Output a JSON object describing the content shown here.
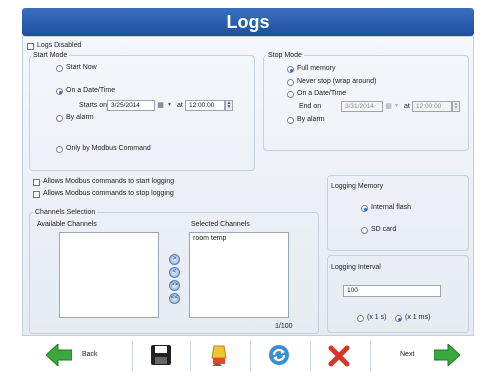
{
  "window": {
    "title": "Logs"
  },
  "options": {
    "logs_disabled": "Logs Disabled"
  },
  "start_mode": {
    "title": "Start Mode",
    "start_now": "Start Now",
    "on_date": "On a Date/Time",
    "starts_on_label": "Starts on",
    "date": "3/25/2014",
    "at_label": "at",
    "time": "12:00:00",
    "by_alarm": "By alarm",
    "only_modbus": "Only by Modbus Command"
  },
  "stop_mode": {
    "title": "Stop Mode",
    "full_memory": "Full memory",
    "never_stop": "Never stop (wrap around)",
    "on_date": "On a Date/Time",
    "end_on_label": "End on",
    "date": "3/31/2014",
    "at_label": "at",
    "time": "12:00:00",
    "by_alarm": "By alarm"
  },
  "modbus": {
    "start": "Allows Modbus commands to start logging",
    "stop": "Allows Modbus commands to stop logging"
  },
  "channels": {
    "title": "Channels Selection",
    "available_label": "Available Channels",
    "selected_label": "Selected Channels",
    "selected_items": [
      "room temp"
    ],
    "count": "1/100",
    "move_buttons": [
      ">",
      "<",
      ">>",
      "<<"
    ]
  },
  "memory": {
    "title": "Logging Memory",
    "internal": "Internal flash",
    "sd": "SD card"
  },
  "interval": {
    "title": "Logging Interval",
    "value": "100",
    "unit_s": "(x 1 s)",
    "unit_ms": "(x 1 ms)"
  },
  "toolbar": {
    "back": "Back",
    "next": "Next",
    "icons": [
      "arrow-left-icon",
      "save-icon",
      "erase-icon",
      "refresh-icon",
      "delete-icon",
      "arrow-right-icon"
    ]
  },
  "colors": {
    "accent": "#2f6bc8",
    "title_bar": "#2a5cab",
    "arrow_green": "#3aa83a",
    "delete_red": "#d9362b"
  }
}
